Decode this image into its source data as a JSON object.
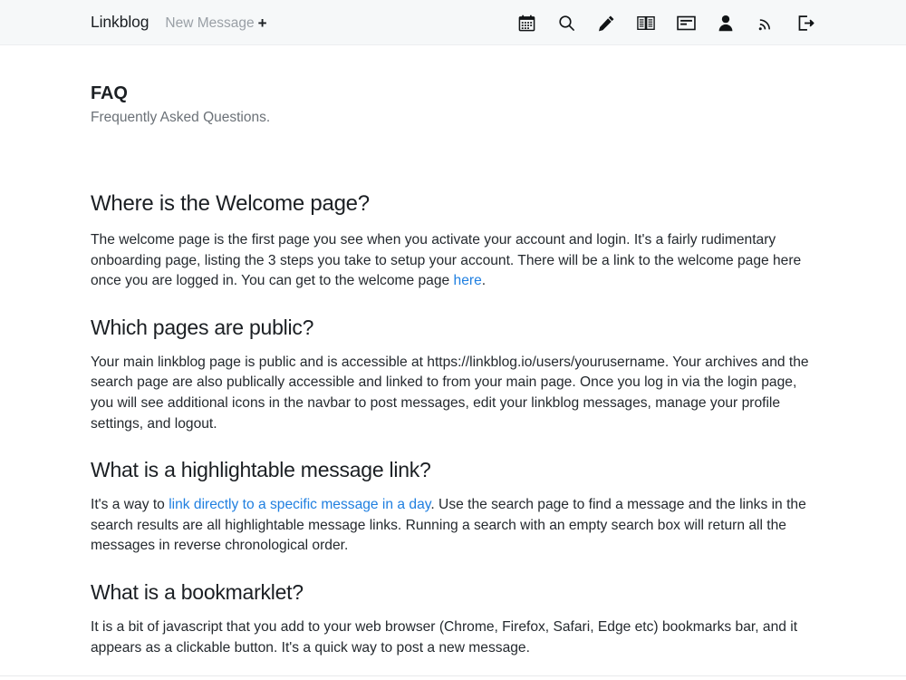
{
  "navbar": {
    "brand": "Linkblog",
    "new_message_label": "New Message",
    "new_message_plus": "+",
    "icons": [
      {
        "name": "calendar-icon",
        "title": "Archives"
      },
      {
        "name": "search-icon",
        "title": "Search"
      },
      {
        "name": "pencil-icon",
        "title": "Post message"
      },
      {
        "name": "book-icon",
        "title": "Read"
      },
      {
        "name": "card-icon",
        "title": "Edit messages"
      },
      {
        "name": "user-icon",
        "title": "Profile"
      },
      {
        "name": "rss-icon",
        "title": "Feed"
      },
      {
        "name": "logout-icon",
        "title": "Logout"
      }
    ],
    "background": "#f6f8f9"
  },
  "page": {
    "title": "FAQ",
    "subtitle": "Frequently Asked Questions."
  },
  "faq": [
    {
      "question": "Where is the Welcome page?",
      "answer_before": "The welcome page is the first page you see when you activate your account and login. It's a fairly rudimentary onboarding page, listing the 3 steps you take to setup your account. There will be a link to the welcome page here once you are logged in. You can get to the welcome page ",
      "link_text": "here",
      "answer_after": "."
    },
    {
      "question": "Which pages are public?",
      "answer_before": "Your main linkblog page is public and is accessible at https://linkblog.io/users/yourusername. Your archives and the search page are also publically accessible and linked to from your main page. Once you log in via the login page, you will see additional icons in the navbar to post messages, edit your linkblog messages, manage your profile settings, and logout.",
      "link_text": "",
      "answer_after": ""
    },
    {
      "question": "What is a highlightable message link?",
      "answer_before": "It's a way to ",
      "link_text": "link directly to a specific message in a day",
      "answer_after": ". Use the search page to find a message and the links in the search results are all highlightable message links. Running a search with an empty search box will return all the messages in reverse chronological order."
    },
    {
      "question": "What is a bookmarklet?",
      "answer_before": "It is a bit of javascript that you add to your web browser (Chrome, Firefox, Safari, Edge etc) bookmarks bar, and it appears as a clickable button. It's a quick way to post a new message.",
      "link_text": "",
      "answer_after": ""
    }
  ],
  "colors": {
    "link": "#1f7fe0",
    "text": "#24292e",
    "muted": "#6b7177",
    "navbar_bg": "#f6f8f9"
  }
}
